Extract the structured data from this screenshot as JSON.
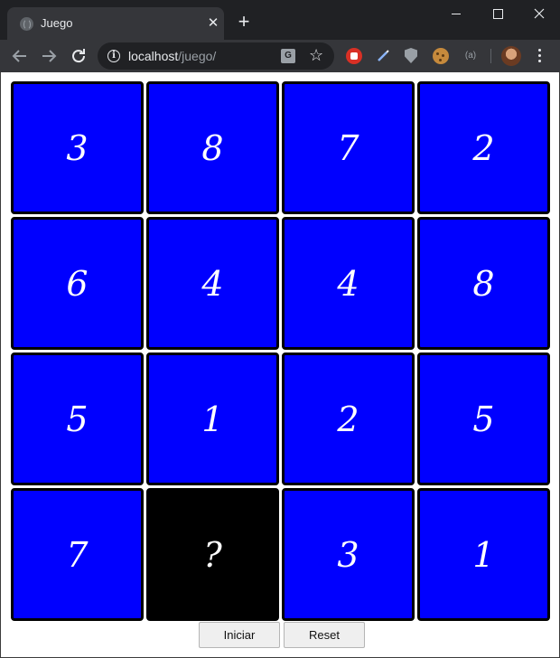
{
  "browser": {
    "tab_title": "Juego",
    "tab_close": "✕",
    "new_tab": "+",
    "url_host": "localhost",
    "url_path": "/juego/",
    "translate_glyph": "G",
    "extension_label": "(a)"
  },
  "board": {
    "tile_color": "#0000ff",
    "hidden_color": "#000000",
    "text_color": "#ffffff",
    "cells": [
      "3",
      "8",
      "7",
      "2",
      "6",
      "4",
      "4",
      "8",
      "5",
      "1",
      "2",
      "5",
      "7",
      "?",
      "3",
      "1"
    ],
    "hidden_index": 13
  },
  "controls": {
    "start_label": "Iniciar",
    "reset_label": "Reset"
  }
}
